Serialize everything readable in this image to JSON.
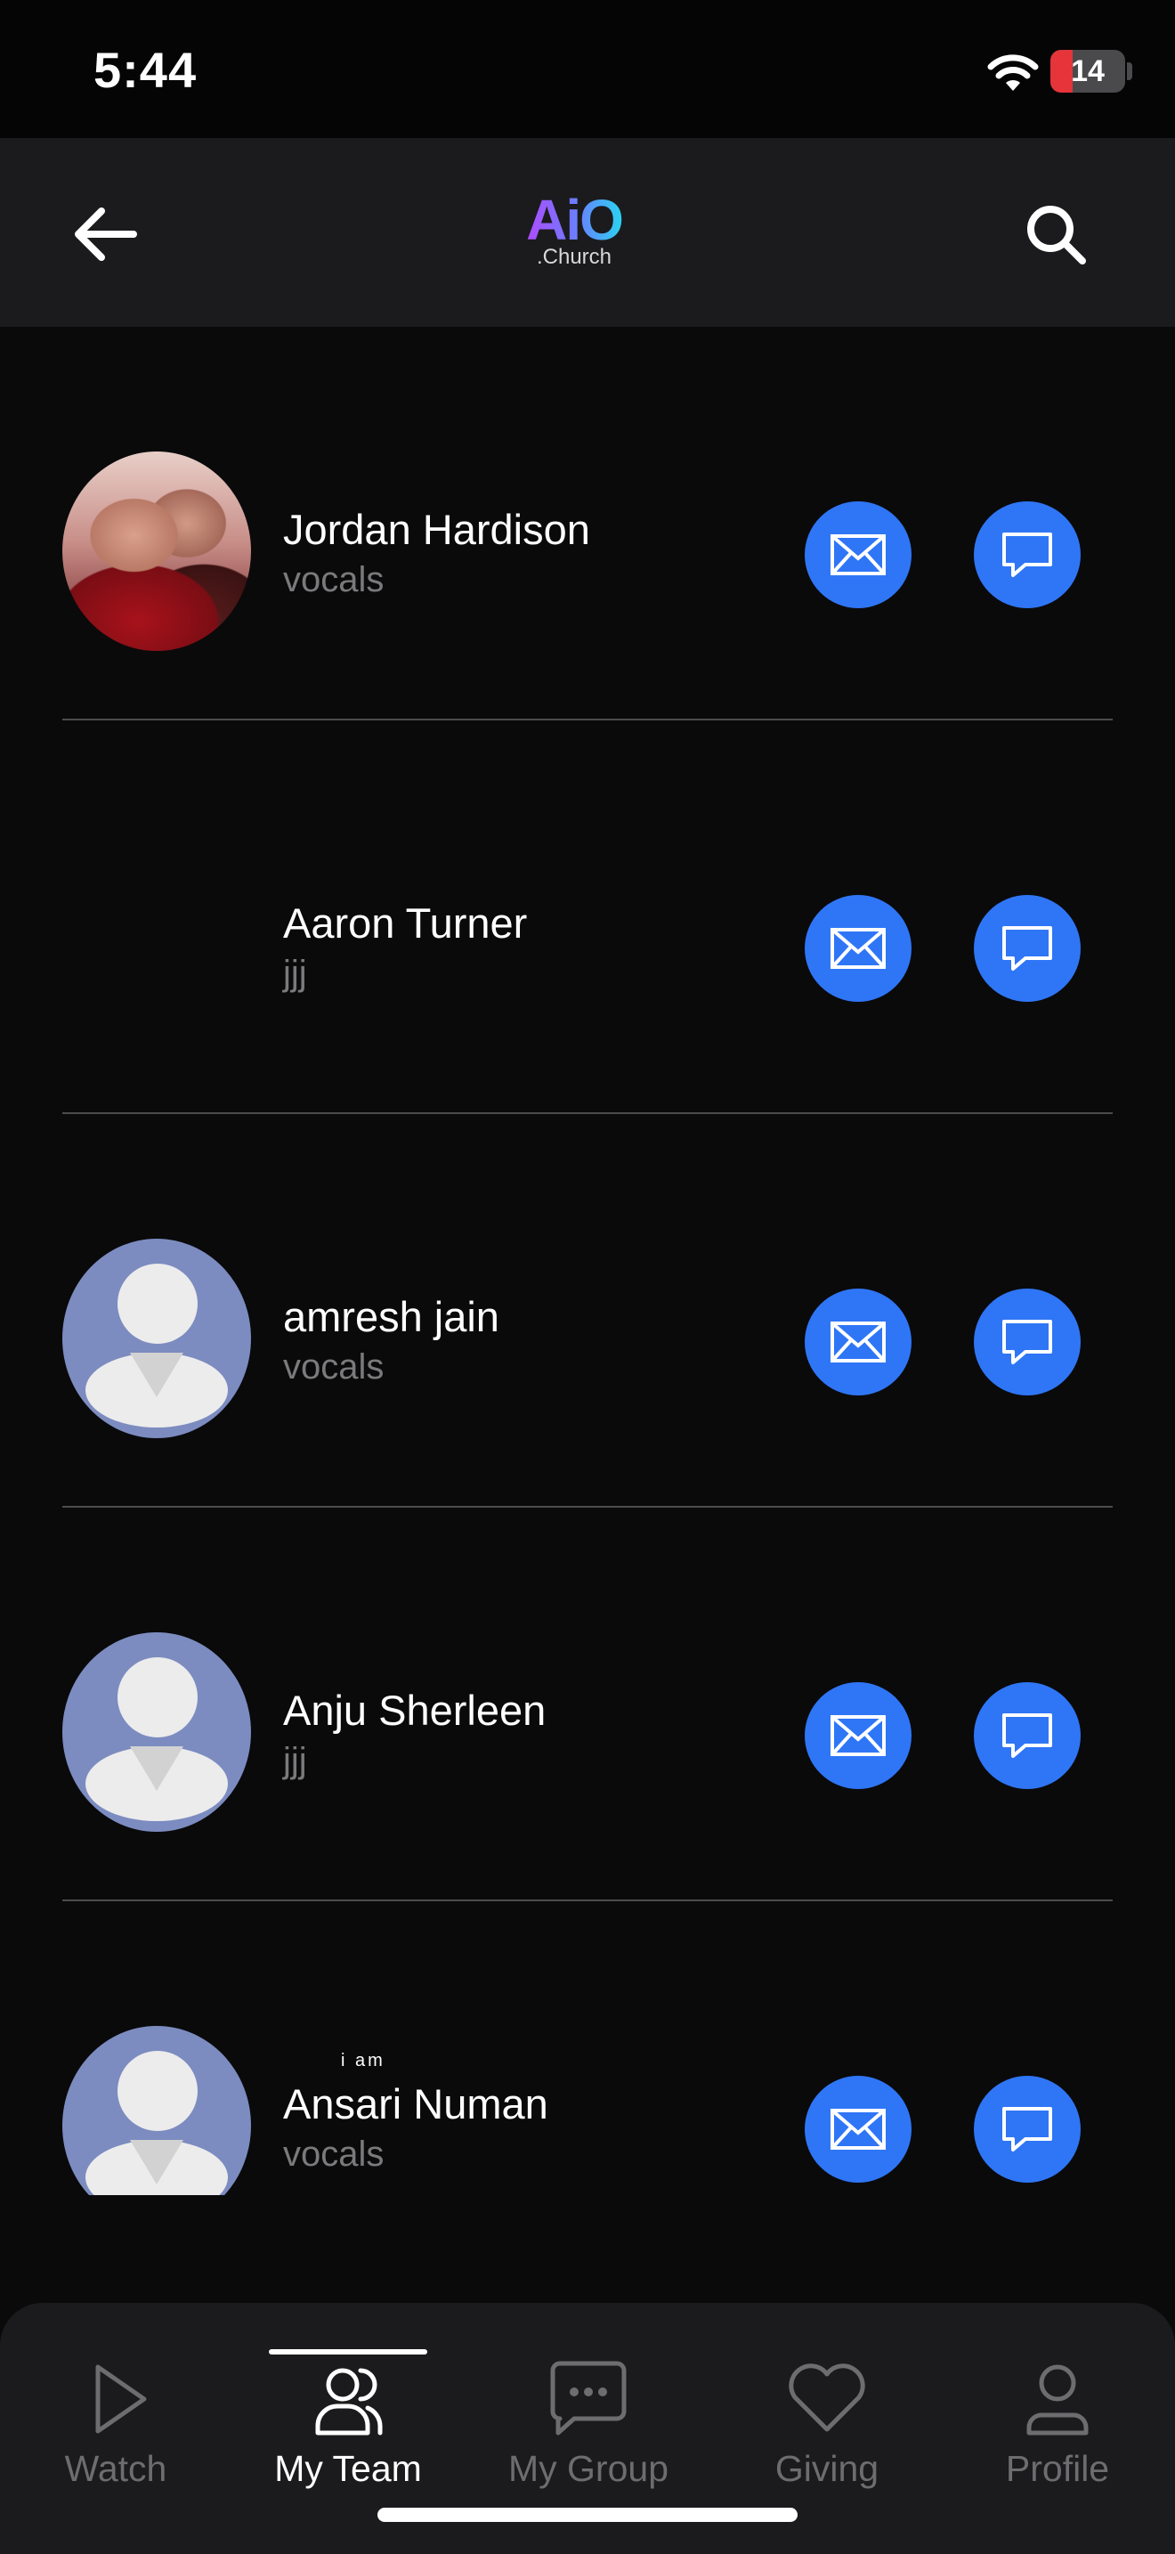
{
  "status_bar": {
    "time": "5:44",
    "battery": "14",
    "battery_icon": "battery-charging-icon",
    "wifi_icon": "wifi-icon"
  },
  "header": {
    "back_icon": "arrow-left-icon",
    "logo_mark": "AiO",
    "logo_sub": ".Church",
    "search_icon": "search-icon"
  },
  "members": [
    {
      "name": "Jordan Hardison",
      "role": "vocals",
      "avatar": "photo"
    },
    {
      "name": "Aaron Turner",
      "role": "jjj",
      "avatar": "blank"
    },
    {
      "name": "amresh jain",
      "role": "vocals",
      "avatar": "default"
    },
    {
      "name": "Anju Sherleen",
      "role": "jjj",
      "avatar": "default"
    },
    {
      "name": "Ansari Numan",
      "role": "vocals",
      "avatar": "default",
      "note": "i am"
    }
  ],
  "tabs": [
    {
      "label": "Watch",
      "icon": "play-icon",
      "active": false
    },
    {
      "label": "My Team",
      "icon": "team-icon",
      "active": true
    },
    {
      "label": "My Group",
      "icon": "chat-bubble-icon",
      "active": false
    },
    {
      "label": "Giving",
      "icon": "heart-icon",
      "active": false
    },
    {
      "label": "Profile",
      "icon": "person-icon",
      "active": false
    }
  ],
  "colors": {
    "accent_blue": "#2f76f6",
    "background": "#0a0a0b",
    "header_bg": "#1b1b1d",
    "muted_text": "#7a7a7c",
    "battery_red": "#e5343a"
  }
}
